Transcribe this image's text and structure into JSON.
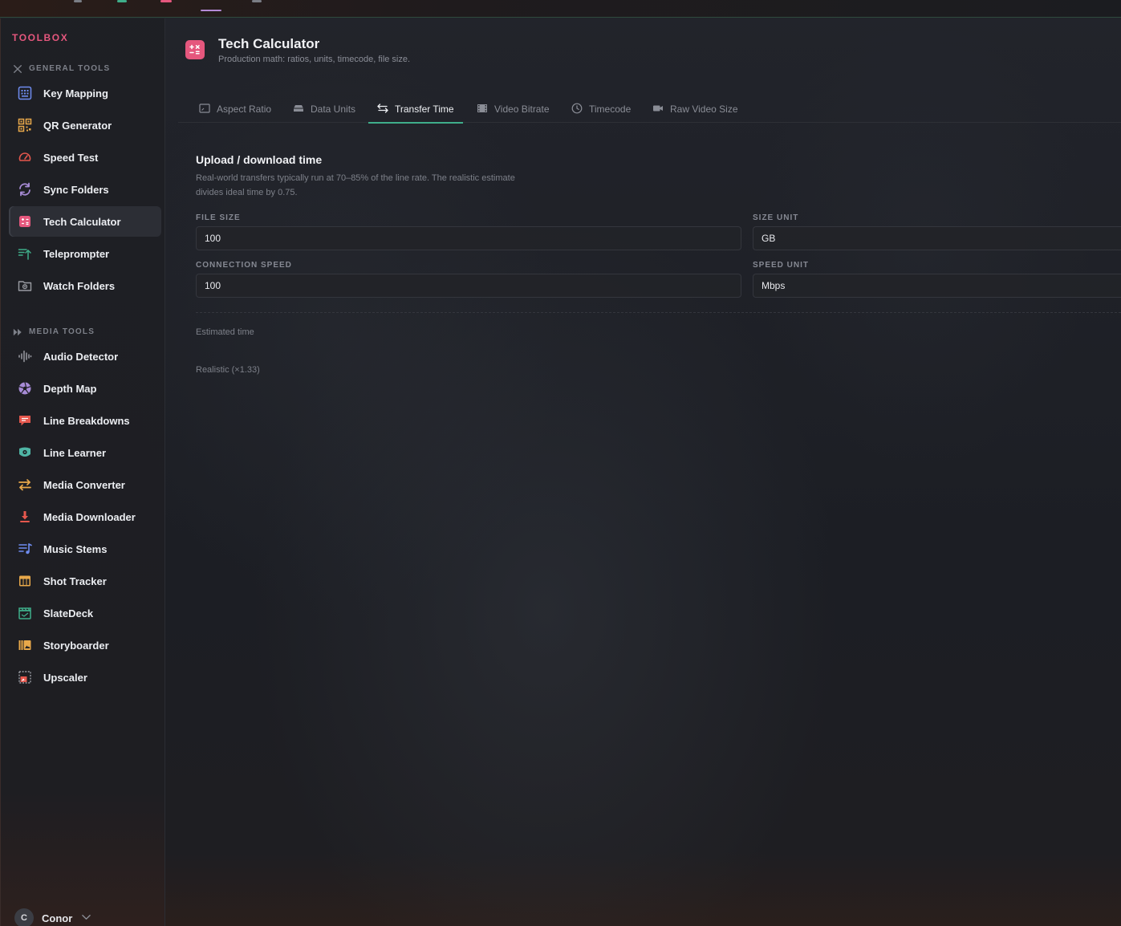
{
  "brand": "TOOLBOX",
  "sidebar": {
    "general_label": "GENERAL TOOLS",
    "media_label": "MEDIA TOOLS",
    "general_items": [
      {
        "label": "Key Mapping"
      },
      {
        "label": "QR Generator"
      },
      {
        "label": "Speed Test"
      },
      {
        "label": "Sync Folders"
      },
      {
        "label": "Tech Calculator",
        "active": true
      },
      {
        "label": "Teleprompter"
      },
      {
        "label": "Watch Folders"
      }
    ],
    "media_items": [
      {
        "label": "Audio Detector"
      },
      {
        "label": "Depth Map"
      },
      {
        "label": "Line Breakdowns"
      },
      {
        "label": "Line Learner"
      },
      {
        "label": "Media Converter"
      },
      {
        "label": "Media Downloader"
      },
      {
        "label": "Music Stems"
      },
      {
        "label": "Shot Tracker"
      },
      {
        "label": "SlateDeck"
      },
      {
        "label": "Storyboarder"
      },
      {
        "label": "Upscaler"
      }
    ],
    "user": {
      "initial": "C",
      "name": "Conor"
    }
  },
  "header": {
    "title": "Tech Calculator",
    "subtitle": "Production math: ratios, units, timecode, file size."
  },
  "tabs": [
    {
      "label": "Aspect Ratio",
      "icon": "aspect-ratio-icon"
    },
    {
      "label": "Data Units",
      "icon": "storage-icon"
    },
    {
      "label": "Transfer Time",
      "icon": "transfer-arrows-icon",
      "active": true
    },
    {
      "label": "Video Bitrate",
      "icon": "film-icon"
    },
    {
      "label": "Timecode",
      "icon": "clock-icon"
    },
    {
      "label": "Raw Video Size",
      "icon": "camera-icon"
    }
  ],
  "transfer": {
    "section_title": "Upload / download time",
    "note": "Real-world transfers typically run at 70–85% of the line rate. The realistic estimate divides ideal time by 0.75.",
    "file_size_label": "FILE SIZE",
    "file_size_value": "100",
    "size_unit_label": "SIZE UNIT",
    "size_unit_value": "GB",
    "connection_speed_label": "CONNECTION SPEED",
    "connection_speed_value": "100",
    "speed_unit_label": "SPEED UNIT",
    "speed_unit_value": "Mbps",
    "estimated_label": "Estimated time",
    "realistic_label": "Realistic (×1.33)"
  },
  "colors": {
    "brand": "#e5577d",
    "active_tab_underline": "#3fae8a",
    "background": "#1a1c22"
  }
}
